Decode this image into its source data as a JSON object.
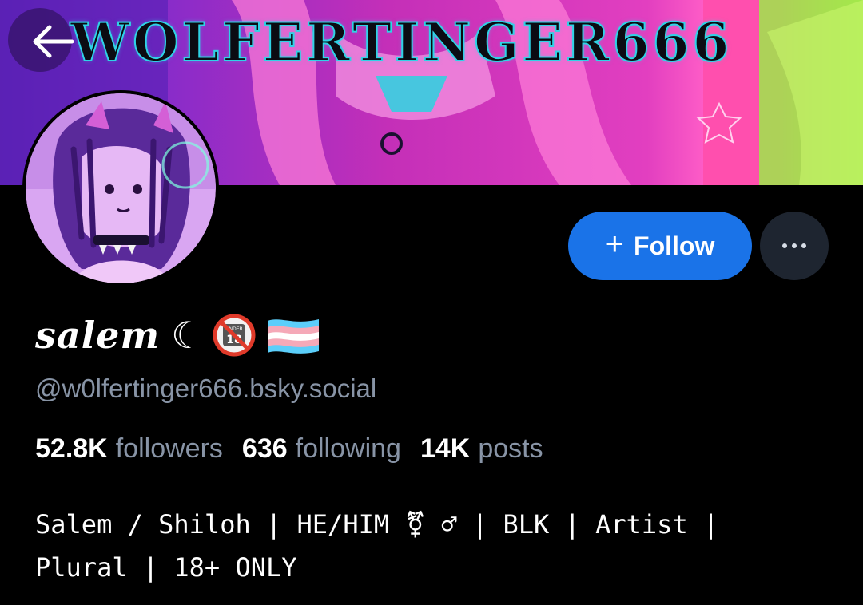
{
  "banner": {
    "title": "WOLFERTINGER666",
    "colors": {
      "purple": "#7c2fd1",
      "magenta": "#d22fb3",
      "pink": "#ff5ec7",
      "cyan": "#2fd3e6",
      "lime": "#b9f04a"
    }
  },
  "navigation": {
    "back_icon": "arrow-left-icon"
  },
  "profile": {
    "display_name": "salem",
    "name_emoji_moon": "☾",
    "name_emoji_under18": "no-under-18-icon",
    "name_emoji_flag": "transgender-flag-icon",
    "handle": "@w0lfertinger666.bsky.social",
    "avatar_icon": "avatar-icon"
  },
  "actions": {
    "follow_label": "Follow",
    "follow_icon": "plus-icon",
    "more_icon": "ellipsis-icon",
    "follow_color": "#1a73e8",
    "more_bg": "#1e2530"
  },
  "stats": {
    "followers_count": "52.8K",
    "followers_label": "followers",
    "following_count": "636",
    "following_label": "following",
    "posts_count": "14K",
    "posts_label": "posts"
  },
  "bio": {
    "line1": "Salem / Shiloh | HE/HIM ⚧ ♂ | BLK | Artist |",
    "line2": "Plural | 18+ ONLY"
  }
}
